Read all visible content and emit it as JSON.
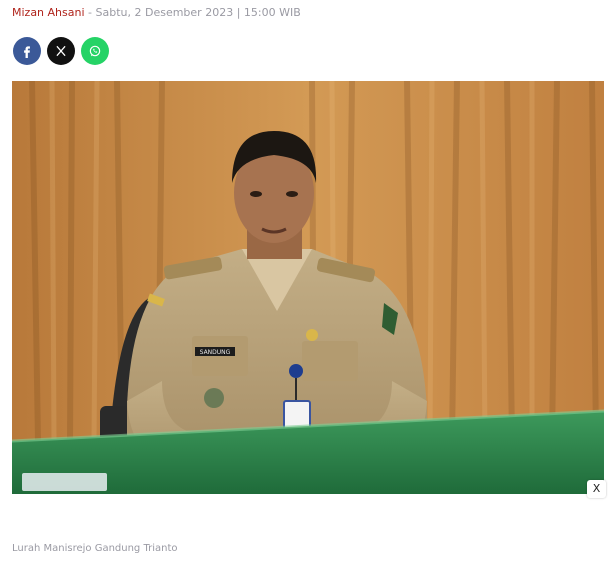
{
  "article": {
    "author": "Mizan Ahsani",
    "separator": " - ",
    "datetime": "Sabtu, 2 Desember 2023 | 15:00 WIB"
  },
  "share": {
    "buttons": [
      {
        "icon": "facebook-icon",
        "color": "#3b5998"
      },
      {
        "icon": "x-twitter-icon",
        "color": "#111111"
      },
      {
        "icon": "whatsapp-icon",
        "color": "#25d366"
      }
    ]
  },
  "photo": {
    "name_tag": "SANDUNG",
    "close_label": "X",
    "caption": "Lurah Manisrejo Gandung Trianto"
  },
  "colors": {
    "author": "#b0241c",
    "meta": "#9a9aa3"
  }
}
